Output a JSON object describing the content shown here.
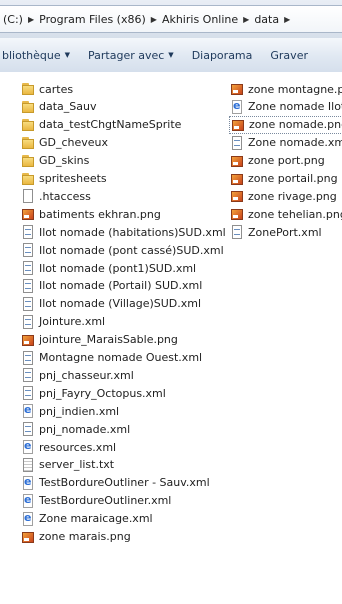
{
  "address_bar": {
    "crumbs": [
      "(C:)",
      "Program Files (x86)",
      "Akhiris Online",
      "data"
    ]
  },
  "toolbar": {
    "library_label": "bliothèque",
    "share_label": "Partager avec",
    "slideshow_label": "Diaporama",
    "burn_label": "Graver"
  },
  "left_column": [
    {
      "name": "cartes",
      "type": "folder"
    },
    {
      "name": "data_Sauv",
      "type": "folder"
    },
    {
      "name": "data_testChgtNameSprite",
      "type": "folder"
    },
    {
      "name": "GD_cheveux",
      "type": "folder"
    },
    {
      "name": "GD_skins",
      "type": "folder"
    },
    {
      "name": "spritesheets",
      "type": "folder"
    },
    {
      "name": ".htaccess",
      "type": "file"
    },
    {
      "name": "batiments ekhran.png",
      "type": "png"
    },
    {
      "name": "Ilot nomade (habitations)SUD.xml",
      "type": "xml"
    },
    {
      "name": "Ilot nomade (pont cassé)SUD.xml",
      "type": "xml"
    },
    {
      "name": "Ilot nomade (pont1)SUD.xml",
      "type": "xml"
    },
    {
      "name": "Ilot nomade (Portail) SUD.xml",
      "type": "xml"
    },
    {
      "name": "Ilot nomade (Village)SUD.xml",
      "type": "xml"
    },
    {
      "name": "Jointure.xml",
      "type": "xml"
    },
    {
      "name": "jointure_MaraisSable.png",
      "type": "png"
    },
    {
      "name": "Montagne nomade Ouest.xml",
      "type": "xml"
    },
    {
      "name": "pnj_chasseur.xml",
      "type": "xml"
    },
    {
      "name": "pnj_Fayry_Octopus.xml",
      "type": "xml"
    },
    {
      "name": "pnj_indien.xml",
      "type": "ie"
    },
    {
      "name": "pnj_nomade.xml",
      "type": "xml"
    },
    {
      "name": "resources.xml",
      "type": "ie"
    },
    {
      "name": "server_list.txt",
      "type": "txt"
    },
    {
      "name": "TestBordureOutliner - Sauv.xml",
      "type": "ie"
    },
    {
      "name": "TestBordureOutliner.xml",
      "type": "ie"
    },
    {
      "name": "Zone maraicage.xml",
      "type": "ie"
    },
    {
      "name": "zone marais.png",
      "type": "png"
    }
  ],
  "right_column": [
    {
      "name": "zone montagne.pn",
      "type": "png"
    },
    {
      "name": "Zone nomade Ilot",
      "type": "ie"
    },
    {
      "name": "zone nomade.png",
      "type": "png",
      "selected": true
    },
    {
      "name": "Zone nomade.xml",
      "type": "xml"
    },
    {
      "name": "zone port.png",
      "type": "png"
    },
    {
      "name": "zone portail.png",
      "type": "png"
    },
    {
      "name": "zone rivage.png",
      "type": "png"
    },
    {
      "name": "zone tehelian.png",
      "type": "png"
    },
    {
      "name": "ZonePort.xml",
      "type": "xml"
    }
  ]
}
